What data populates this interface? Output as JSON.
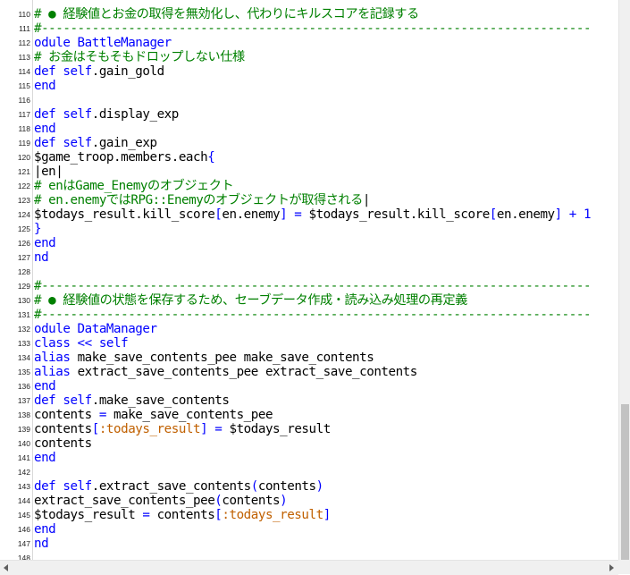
{
  "editor": {
    "lines": [
      {
        "num": "110",
        "tokens": [
          {
            "t": "# ● 経験値とお金の取得を無効化し、代わりにキルスコアを記録する",
            "c": "comment"
          }
        ]
      },
      {
        "num": "111",
        "tokens": [
          {
            "t": "#----------------------------------------------------------------------------",
            "c": "comment"
          }
        ]
      },
      {
        "num": "112",
        "tokens": [
          {
            "t": "odule BattleManager",
            "c": "kw"
          }
        ]
      },
      {
        "num": "113",
        "tokens": [
          {
            "t": " # お金はそもそもドロップしない仕様",
            "c": "comment"
          }
        ]
      },
      {
        "num": "114",
        "tokens": [
          {
            "t": " def ",
            "c": "kw"
          },
          {
            "t": "self",
            "c": "kw"
          },
          {
            "t": ".gain_gold",
            "c": "plain"
          }
        ]
      },
      {
        "num": "115",
        "tokens": [
          {
            "t": " end",
            "c": "kw"
          }
        ]
      },
      {
        "num": "116",
        "tokens": []
      },
      {
        "num": "117",
        "tokens": [
          {
            "t": " def ",
            "c": "kw"
          },
          {
            "t": "self",
            "c": "kw"
          },
          {
            "t": ".display_exp",
            "c": "plain"
          }
        ]
      },
      {
        "num": "118",
        "tokens": [
          {
            "t": " end",
            "c": "kw"
          }
        ]
      },
      {
        "num": "119",
        "tokens": [
          {
            "t": " def ",
            "c": "kw"
          },
          {
            "t": "self",
            "c": "kw"
          },
          {
            "t": ".gain_exp",
            "c": "plain"
          }
        ]
      },
      {
        "num": "120",
        "tokens": [
          {
            "t": "   $game_troop.members.each",
            "c": "plain"
          },
          {
            "t": "{",
            "c": "kw"
          }
        ]
      },
      {
        "num": "121",
        "tokens": [
          {
            "t": "     |en|",
            "c": "plain"
          }
        ]
      },
      {
        "num": "122",
        "tokens": [
          {
            "t": "     # enはGame_Enemyのオブジェクト",
            "c": "comment"
          }
        ]
      },
      {
        "num": "123",
        "tokens": [
          {
            "t": "     # en.enemyではRPG::Enemyのオブジェクトが取得される",
            "c": "comment"
          },
          {
            "t": "|",
            "c": "plain"
          }
        ]
      },
      {
        "num": "124",
        "tokens": [
          {
            "t": "     $todays_result.kill_score",
            "c": "plain"
          },
          {
            "t": "[",
            "c": "kw"
          },
          {
            "t": "en.enemy",
            "c": "plain"
          },
          {
            "t": "] = ",
            "c": "kw"
          },
          {
            "t": "$todays_result.kill_score",
            "c": "plain"
          },
          {
            "t": "[",
            "c": "kw"
          },
          {
            "t": "en.enemy",
            "c": "plain"
          },
          {
            "t": "] + 1",
            "c": "kw"
          }
        ]
      },
      {
        "num": "125",
        "tokens": [
          {
            "t": "   }",
            "c": "kw"
          }
        ]
      },
      {
        "num": "126",
        "tokens": [
          {
            "t": " end",
            "c": "kw"
          }
        ]
      },
      {
        "num": "127",
        "tokens": [
          {
            "t": "nd",
            "c": "kw"
          }
        ]
      },
      {
        "num": "128",
        "tokens": []
      },
      {
        "num": "129",
        "tokens": [
          {
            "t": "#----------------------------------------------------------------------------",
            "c": "comment"
          }
        ]
      },
      {
        "num": "130",
        "tokens": [
          {
            "t": "# ● 経験値の状態を保存するため、セーブデータ作成・読み込み処理の再定義",
            "c": "comment"
          }
        ]
      },
      {
        "num": "131",
        "tokens": [
          {
            "t": "#----------------------------------------------------------------------------",
            "c": "comment"
          }
        ]
      },
      {
        "num": "132",
        "tokens": [
          {
            "t": "odule DataManager",
            "c": "kw"
          }
        ]
      },
      {
        "num": "133",
        "tokens": [
          {
            "t": " class << self",
            "c": "kw"
          }
        ]
      },
      {
        "num": "134",
        "tokens": [
          {
            "t": "   alias ",
            "c": "kw"
          },
          {
            "t": "make_save_contents_pee make_save_contents",
            "c": "plain"
          }
        ]
      },
      {
        "num": "135",
        "tokens": [
          {
            "t": "   alias ",
            "c": "kw"
          },
          {
            "t": "extract_save_contents_pee extract_save_contents",
            "c": "plain"
          }
        ]
      },
      {
        "num": "136",
        "tokens": [
          {
            "t": " end",
            "c": "kw"
          }
        ]
      },
      {
        "num": "137",
        "tokens": [
          {
            "t": " def ",
            "c": "kw"
          },
          {
            "t": "self",
            "c": "kw"
          },
          {
            "t": ".make_save_contents",
            "c": "plain"
          }
        ]
      },
      {
        "num": "138",
        "tokens": [
          {
            "t": "   contents ",
            "c": "plain"
          },
          {
            "t": "= ",
            "c": "kw"
          },
          {
            "t": "make_save_contents_pee",
            "c": "plain"
          }
        ]
      },
      {
        "num": "139",
        "tokens": [
          {
            "t": "   contents",
            "c": "plain"
          },
          {
            "t": "[",
            "c": "kw"
          },
          {
            "t": ":todays_result",
            "c": "sym"
          },
          {
            "t": "] = ",
            "c": "kw"
          },
          {
            "t": "$todays_result",
            "c": "plain"
          }
        ]
      },
      {
        "num": "140",
        "tokens": [
          {
            "t": "   contents",
            "c": "plain"
          }
        ]
      },
      {
        "num": "141",
        "tokens": [
          {
            "t": " end",
            "c": "kw"
          }
        ]
      },
      {
        "num": "142",
        "tokens": []
      },
      {
        "num": "143",
        "tokens": [
          {
            "t": " def ",
            "c": "kw"
          },
          {
            "t": "self",
            "c": "kw"
          },
          {
            "t": ".extract_save_contents",
            "c": "plain"
          },
          {
            "t": "(",
            "c": "kw"
          },
          {
            "t": "contents",
            "c": "plain"
          },
          {
            "t": ")",
            "c": "kw"
          }
        ]
      },
      {
        "num": "144",
        "tokens": [
          {
            "t": "   extract_save_contents_pee",
            "c": "plain"
          },
          {
            "t": "(",
            "c": "kw"
          },
          {
            "t": "contents",
            "c": "plain"
          },
          {
            "t": ")",
            "c": "kw"
          }
        ]
      },
      {
        "num": "145",
        "tokens": [
          {
            "t": "   $todays_result ",
            "c": "plain"
          },
          {
            "t": "= ",
            "c": "kw"
          },
          {
            "t": "contents",
            "c": "plain"
          },
          {
            "t": "[",
            "c": "kw"
          },
          {
            "t": ":todays_result",
            "c": "sym"
          },
          {
            "t": "]",
            "c": "kw"
          }
        ]
      },
      {
        "num": "146",
        "tokens": [
          {
            "t": " end",
            "c": "kw"
          }
        ]
      },
      {
        "num": "147",
        "tokens": [
          {
            "t": "nd",
            "c": "kw"
          }
        ]
      },
      {
        "num": "148",
        "tokens": []
      }
    ]
  },
  "colors": {
    "comment": "#008000",
    "keyword": "#0000ff",
    "symbol": "#c06000",
    "plain": "#000000",
    "gutter_text": "#222222"
  },
  "scrollbars": {
    "vertical_position": 0.72
  }
}
